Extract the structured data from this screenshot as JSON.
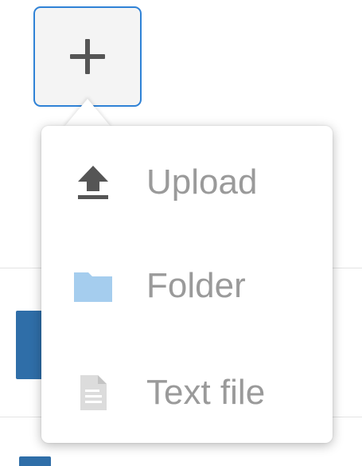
{
  "new_button": {
    "icon": "plus-icon"
  },
  "menu": {
    "items": [
      {
        "label": "Upload",
        "icon": "upload-icon",
        "color": "#555555"
      },
      {
        "label": "Folder",
        "icon": "folder-icon",
        "color": "#a5cdee"
      },
      {
        "label": "Text file",
        "icon": "text-file-icon",
        "color": "#dcdcdc"
      }
    ]
  },
  "colors": {
    "button_border": "#2f82d6",
    "label_text": "#9a9a9a",
    "background_accent": "#2f6ea8"
  }
}
